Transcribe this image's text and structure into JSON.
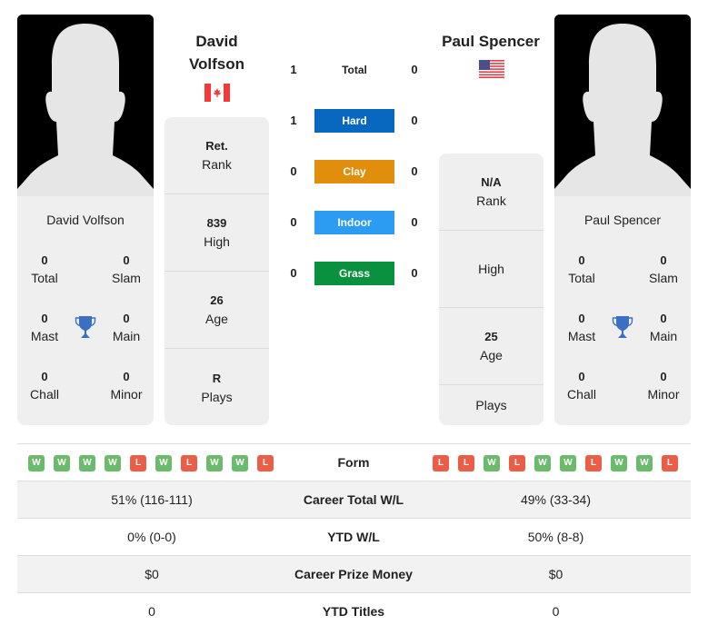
{
  "colors": {
    "hard": "#0868bf",
    "clay": "#e08e0b",
    "indoor": "#2b9cf2",
    "grass": "#0a9140",
    "win": "#6cbb6c",
    "loss": "#ec5d47",
    "trophy": "#3a6fc4"
  },
  "player1": {
    "name": "David Volfson",
    "header_name_line1": "David",
    "header_name_line2": "Volfson",
    "flag": "canada-flag-icon",
    "titles": {
      "total": {
        "value": "0",
        "label": "Total"
      },
      "slam": {
        "value": "0",
        "label": "Slam"
      },
      "mast": {
        "value": "0",
        "label": "Mast"
      },
      "main": {
        "value": "0",
        "label": "Main"
      },
      "chall": {
        "value": "0",
        "label": "Chall"
      },
      "minor": {
        "value": "0",
        "label": "Minor"
      }
    },
    "stats": [
      {
        "value": "Ret.",
        "label": "Rank"
      },
      {
        "value": "839",
        "label": "High"
      },
      {
        "value": "26",
        "label": "Age"
      },
      {
        "value": "R",
        "label": "Plays"
      }
    ],
    "form": [
      "W",
      "W",
      "W",
      "W",
      "L",
      "W",
      "L",
      "W",
      "W",
      "L"
    ]
  },
  "player2": {
    "name": "Paul Spencer",
    "header_name": "Paul Spencer",
    "flag": "usa-flag-icon",
    "titles": {
      "total": {
        "value": "0",
        "label": "Total"
      },
      "slam": {
        "value": "0",
        "label": "Slam"
      },
      "mast": {
        "value": "0",
        "label": "Mast"
      },
      "main": {
        "value": "0",
        "label": "Main"
      },
      "chall": {
        "value": "0",
        "label": "Chall"
      },
      "minor": {
        "value": "0",
        "label": "Minor"
      }
    },
    "stats": [
      {
        "value": "N/A",
        "label": "Rank"
      },
      {
        "value": "",
        "label": "High"
      },
      {
        "value": "25",
        "label": "Age"
      },
      {
        "value": "",
        "label": "Plays"
      }
    ],
    "form": [
      "L",
      "L",
      "W",
      "L",
      "W",
      "W",
      "L",
      "W",
      "W",
      "L"
    ]
  },
  "h2h": [
    {
      "label": "Total",
      "left": "1",
      "right": "0",
      "surface": "total"
    },
    {
      "label": "Hard",
      "left": "1",
      "right": "0",
      "surface": "hard"
    },
    {
      "label": "Clay",
      "left": "0",
      "right": "0",
      "surface": "clay"
    },
    {
      "label": "Indoor",
      "left": "0",
      "right": "0",
      "surface": "indoor"
    },
    {
      "label": "Grass",
      "left": "0",
      "right": "0",
      "surface": "grass"
    }
  ],
  "comparison": {
    "form_label": "Form",
    "rows": [
      {
        "label": "Career Total W/L",
        "left": "51% (116-111)",
        "right": "49% (33-34)"
      },
      {
        "label": "YTD W/L",
        "left": "0% (0-0)",
        "right": "50% (8-8)"
      },
      {
        "label": "Career Prize Money",
        "left": "$0",
        "right": "$0"
      },
      {
        "label": "YTD Titles",
        "left": "0",
        "right": "0"
      }
    ]
  }
}
